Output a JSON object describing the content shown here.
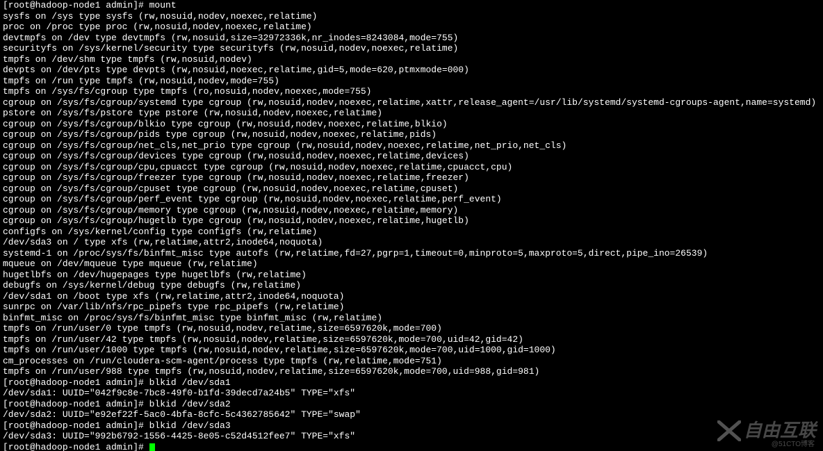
{
  "prompt_user": "root",
  "prompt_host": "hadoop-node1",
  "prompt_path": "admin",
  "prompt_suffix": "#",
  "commands": {
    "mount": "mount",
    "blkid1": "blkid /dev/sda1",
    "blkid2": "blkid /dev/sda2",
    "blkid3": "blkid /dev/sda3"
  },
  "mount_output": [
    "sysfs on /sys type sysfs (rw,nosuid,nodev,noexec,relatime)",
    "proc on /proc type proc (rw,nosuid,nodev,noexec,relatime)",
    "devtmpfs on /dev type devtmpfs (rw,nosuid,size=32972336k,nr_inodes=8243084,mode=755)",
    "securityfs on /sys/kernel/security type securityfs (rw,nosuid,nodev,noexec,relatime)",
    "tmpfs on /dev/shm type tmpfs (rw,nosuid,nodev)",
    "devpts on /dev/pts type devpts (rw,nosuid,noexec,relatime,gid=5,mode=620,ptmxmode=000)",
    "tmpfs on /run type tmpfs (rw,nosuid,nodev,mode=755)",
    "tmpfs on /sys/fs/cgroup type tmpfs (ro,nosuid,nodev,noexec,mode=755)",
    "cgroup on /sys/fs/cgroup/systemd type cgroup (rw,nosuid,nodev,noexec,relatime,xattr,release_agent=/usr/lib/systemd/systemd-cgroups-agent,name=systemd)",
    "pstore on /sys/fs/pstore type pstore (rw,nosuid,nodev,noexec,relatime)",
    "cgroup on /sys/fs/cgroup/blkio type cgroup (rw,nosuid,nodev,noexec,relatime,blkio)",
    "cgroup on /sys/fs/cgroup/pids type cgroup (rw,nosuid,nodev,noexec,relatime,pids)",
    "cgroup on /sys/fs/cgroup/net_cls,net_prio type cgroup (rw,nosuid,nodev,noexec,relatime,net_prio,net_cls)",
    "cgroup on /sys/fs/cgroup/devices type cgroup (rw,nosuid,nodev,noexec,relatime,devices)",
    "cgroup on /sys/fs/cgroup/cpu,cpuacct type cgroup (rw,nosuid,nodev,noexec,relatime,cpuacct,cpu)",
    "cgroup on /sys/fs/cgroup/freezer type cgroup (rw,nosuid,nodev,noexec,relatime,freezer)",
    "cgroup on /sys/fs/cgroup/cpuset type cgroup (rw,nosuid,nodev,noexec,relatime,cpuset)",
    "cgroup on /sys/fs/cgroup/perf_event type cgroup (rw,nosuid,nodev,noexec,relatime,perf_event)",
    "cgroup on /sys/fs/cgroup/memory type cgroup (rw,nosuid,nodev,noexec,relatime,memory)",
    "cgroup on /sys/fs/cgroup/hugetlb type cgroup (rw,nosuid,nodev,noexec,relatime,hugetlb)",
    "configfs on /sys/kernel/config type configfs (rw,relatime)",
    "/dev/sda3 on / type xfs (rw,relatime,attr2,inode64,noquota)",
    "systemd-1 on /proc/sys/fs/binfmt_misc type autofs (rw,relatime,fd=27,pgrp=1,timeout=0,minproto=5,maxproto=5,direct,pipe_ino=26539)",
    "mqueue on /dev/mqueue type mqueue (rw,relatime)",
    "hugetlbfs on /dev/hugepages type hugetlbfs (rw,relatime)",
    "debugfs on /sys/kernel/debug type debugfs (rw,relatime)",
    "/dev/sda1 on /boot type xfs (rw,relatime,attr2,inode64,noquota)",
    "sunrpc on /var/lib/nfs/rpc_pipefs type rpc_pipefs (rw,relatime)",
    "binfmt_misc on /proc/sys/fs/binfmt_misc type binfmt_misc (rw,relatime)",
    "tmpfs on /run/user/0 type tmpfs (rw,nosuid,nodev,relatime,size=6597620k,mode=700)",
    "tmpfs on /run/user/42 type tmpfs (rw,nosuid,nodev,relatime,size=6597620k,mode=700,uid=42,gid=42)",
    "tmpfs on /run/user/1000 type tmpfs (rw,nosuid,nodev,relatime,size=6597620k,mode=700,uid=1000,gid=1000)",
    "cm_processes on /run/cloudera-scm-agent/process type tmpfs (rw,relatime,mode=751)",
    "tmpfs on /run/user/988 type tmpfs (rw,nosuid,nodev,relatime,size=6597620k,mode=700,uid=988,gid=981)"
  ],
  "blkid_output": {
    "sda1": "/dev/sda1: UUID=\"042f9c8e-7bc8-49f0-b1fd-39decd7a24b5\" TYPE=\"xfs\"",
    "sda2": "/dev/sda2: UUID=\"e92ef22f-5ac0-4bfa-8cfc-5c4362785642\" TYPE=\"swap\"",
    "sda3": "/dev/sda3: UUID=\"992b6792-1556-4425-8e05-c52d4512fee7\" TYPE=\"xfs\""
  },
  "watermark": {
    "main": "自由互联",
    "sub": "@51CTO博客"
  }
}
